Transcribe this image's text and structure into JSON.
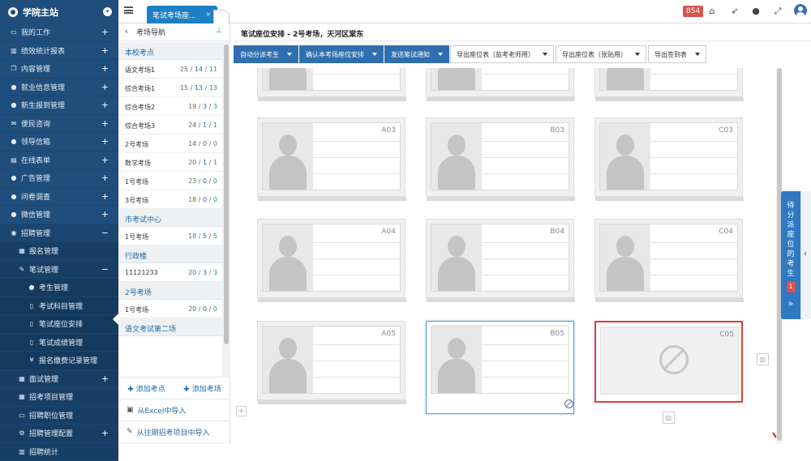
{
  "app": {
    "brand": "学院主站",
    "tab_label": "笔试考场座..."
  },
  "topbar": {
    "badge_count": "854"
  },
  "sidebar": {
    "items": [
      {
        "label": "我的工作",
        "icon": "laptop-icon",
        "toggle": "+"
      },
      {
        "label": "绩效统计报表",
        "icon": "chart-icon",
        "toggle": "+"
      },
      {
        "label": "内容管理",
        "icon": "copy-icon",
        "toggle": "+"
      },
      {
        "label": "就业信息管理",
        "icon": "users-icon",
        "toggle": "+"
      },
      {
        "label": "新生报到管理",
        "icon": "group-icon",
        "toggle": "+"
      },
      {
        "label": "便民咨询",
        "icon": "envelope-icon",
        "toggle": "+"
      },
      {
        "label": "领导信箱",
        "icon": "mailbox-icon",
        "toggle": "+"
      },
      {
        "label": "在线表单",
        "icon": "form-icon",
        "toggle": "+"
      },
      {
        "label": "广告管理",
        "icon": "ad-icon",
        "toggle": "+"
      },
      {
        "label": "问卷调查",
        "icon": "survey-icon",
        "toggle": "+"
      },
      {
        "label": "微信管理",
        "icon": "wechat-icon",
        "toggle": "+"
      },
      {
        "label": "招聘管理",
        "icon": "eye-icon",
        "toggle": "−"
      },
      {
        "label": "报名管理",
        "icon": "table-icon",
        "toggle": ""
      },
      {
        "label": "笔试管理",
        "icon": "pencil-icon",
        "toggle": "−"
      },
      {
        "label": "考生管理",
        "icon": "people-icon",
        "toggle": ""
      },
      {
        "label": "考试科目管理",
        "icon": "file-icon",
        "toggle": ""
      },
      {
        "label": "笔试座位安排",
        "icon": "file-icon",
        "toggle": ""
      },
      {
        "label": "笔试成绩管理",
        "icon": "file-icon",
        "toggle": ""
      },
      {
        "label": "报名缴费记录管理",
        "icon": "yen-icon",
        "toggle": ""
      },
      {
        "label": "面试管理",
        "icon": "grid-icon",
        "toggle": "+"
      },
      {
        "label": "招考项目管理",
        "icon": "table-icon",
        "toggle": ""
      },
      {
        "label": "招聘职位管理",
        "icon": "card-icon",
        "toggle": ""
      },
      {
        "label": "招聘管理配置",
        "icon": "gear-icon",
        "toggle": "+"
      },
      {
        "label": "招聘统计",
        "icon": "chart-icon",
        "toggle": ""
      }
    ]
  },
  "nav": {
    "title": "考场导航",
    "groups": [
      {
        "name": "本校考点",
        "rooms": [
          {
            "name": "语文考场1",
            "a": "25",
            "b": "14",
            "c": "11"
          },
          {
            "name": "综合考场1",
            "a": "15",
            "b": "13",
            "c": "13"
          },
          {
            "name": "综合考场2",
            "a": "19",
            "b": "3",
            "c": "3"
          },
          {
            "name": "综合考场3",
            "a": "24",
            "b": "1",
            "c": "1"
          },
          {
            "name": "2号考场",
            "a": "14",
            "b": "0",
            "c": "0"
          },
          {
            "name": "数学考场",
            "a": "20",
            "b": "1",
            "c": "1"
          },
          {
            "name": "1号考场",
            "a": "23",
            "b": "0",
            "c": "0"
          },
          {
            "name": "3号考场",
            "a": "18",
            "b": "0",
            "c": "0"
          }
        ]
      },
      {
        "name": "市考试中心",
        "rooms": [
          {
            "name": "1号考场",
            "a": "18",
            "b": "5",
            "c": "5"
          }
        ]
      },
      {
        "name": "行政楼",
        "rooms": [
          {
            "name": "11121233",
            "a": "20",
            "b": "3",
            "c": "3"
          }
        ]
      },
      {
        "name": "2号考场",
        "rooms": [
          {
            "name": "1号考场",
            "a": "20",
            "b": "0",
            "c": "0"
          }
        ]
      },
      {
        "name": "语文考试第二场",
        "rooms": []
      }
    ],
    "add_site": "添加考点",
    "add_room": "添加考场",
    "import_excel": "从Excel中导入",
    "import_past": "从往期招考项目中导入"
  },
  "main": {
    "title": "笔试座位安排 - 2号考场，天河区棠东",
    "buttons": {
      "auto_assign": "自动分派考生",
      "confirm": "确认本考场座位安排",
      "send_notice": "发送笔试通知",
      "export_proctor": "导出座位表（监考老师用）",
      "export_post": "导出座位表（张贴用）",
      "export_signin": "导出签到表"
    },
    "seats_row3": [
      "A03",
      "B03",
      "C03"
    ],
    "seats_row4": [
      "A04",
      "B04",
      "C04"
    ],
    "seats_row5": [
      "A05",
      "B05",
      "C05"
    ]
  },
  "right_panel": {
    "label": "待分派座位的考生",
    "count": "1",
    "expand": "»"
  },
  "collapse": "‹"
}
